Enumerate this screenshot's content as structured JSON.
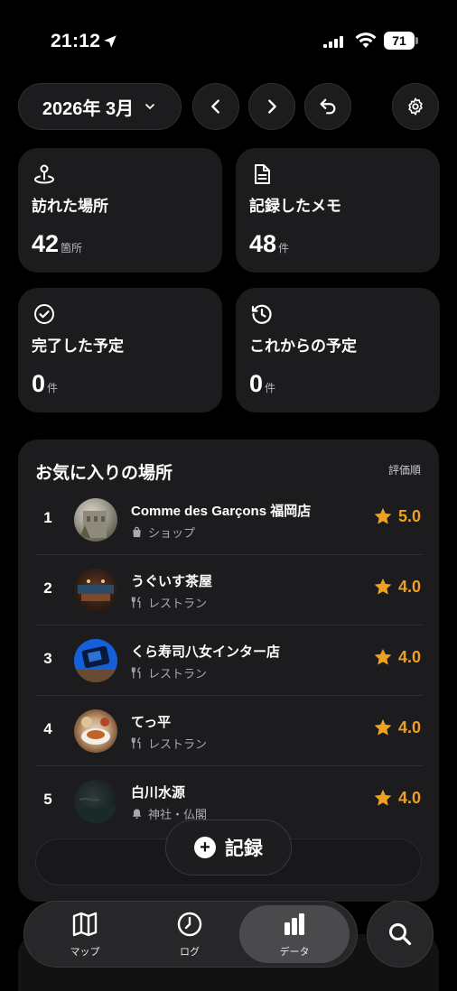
{
  "status_bar": {
    "time": "21:12",
    "battery": "71"
  },
  "header": {
    "month_label": "2026年 3月"
  },
  "stats": [
    {
      "icon": "map-pin-icon",
      "label": "訪れた場所",
      "value": "42",
      "unit": "箇所"
    },
    {
      "icon": "document-icon",
      "label": "記録したメモ",
      "value": "48",
      "unit": "件"
    },
    {
      "icon": "check-circle-icon",
      "label": "完了した予定",
      "value": "0",
      "unit": "件"
    },
    {
      "icon": "history-icon",
      "label": "これからの予定",
      "value": "0",
      "unit": "件"
    }
  ],
  "favorites": {
    "title": "お気に入りの場所",
    "sort_label": "評価順",
    "items": [
      {
        "rank": "1",
        "name": "Comme des Garçons 福岡店",
        "category": "ショップ",
        "category_icon": "bag-icon",
        "rating": "5.0"
      },
      {
        "rank": "2",
        "name": "うぐいす茶屋",
        "category": "レストラン",
        "category_icon": "utensils-icon",
        "rating": "4.0"
      },
      {
        "rank": "3",
        "name": "くら寿司八女インター店",
        "category": "レストラン",
        "category_icon": "utensils-icon",
        "rating": "4.0"
      },
      {
        "rank": "4",
        "name": "てっ平",
        "category": "レストラン",
        "category_icon": "utensils-icon",
        "rating": "4.0"
      },
      {
        "rank": "5",
        "name": "白川水源",
        "category": "神社・仏閣",
        "category_icon": "bell-icon",
        "rating": "4.0"
      }
    ]
  },
  "record_button": {
    "label": "記録"
  },
  "tabbar": {
    "tabs": [
      {
        "label": "マップ",
        "icon": "map-icon"
      },
      {
        "label": "ログ",
        "icon": "clock-icon"
      },
      {
        "label": "データ",
        "icon": "bar-chart-icon",
        "active": true
      }
    ]
  },
  "colors": {
    "background": "#000000",
    "card": "#1c1c1e",
    "rating": "#f0a020"
  }
}
